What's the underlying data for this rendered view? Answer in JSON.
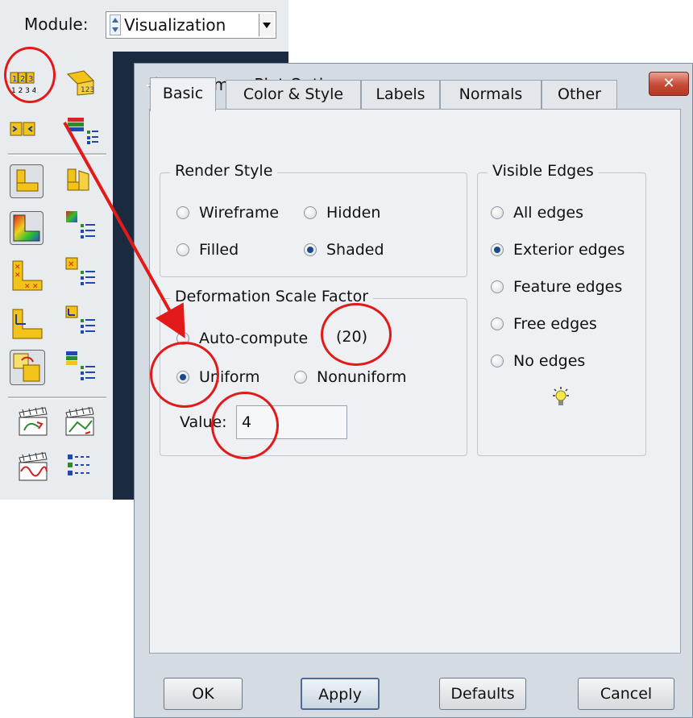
{
  "module_bar": {
    "label": "Module:",
    "selected": "Visualization"
  },
  "dialog": {
    "title": "Common Plot Options",
    "close_glyph": "✕",
    "tabs": [
      "Basic",
      "Color & Style",
      "Labels",
      "Normals",
      "Other"
    ],
    "active_tab": "Basic",
    "render_style": {
      "title": "Render Style",
      "options": [
        "Wireframe",
        "Hidden",
        "Filled",
        "Shaded"
      ],
      "selected": "Shaded"
    },
    "deformation": {
      "title": "Deformation Scale Factor",
      "auto_label": "Auto-compute",
      "auto_value": "(20)",
      "uniform_label": "Uniform",
      "nonuniform_label": "Nonuniform",
      "selected": "Uniform",
      "value_label": "Value:",
      "value": "4"
    },
    "visible_edges": {
      "title": "Visible Edges",
      "options": [
        "All edges",
        "Exterior edges",
        "Feature edges",
        "Free edges",
        "No edges"
      ],
      "selected": "Exterior edges"
    },
    "buttons": {
      "ok": "OK",
      "apply": "Apply",
      "defaults": "Defaults",
      "cancel": "Cancel"
    }
  },
  "colors": {
    "annotation": "#e21a1a",
    "selected_radio": "#1a4a8a",
    "canvas": "#1c2a40"
  },
  "icons": [
    "common-plot-options-icon",
    "annotation-arrow"
  ]
}
